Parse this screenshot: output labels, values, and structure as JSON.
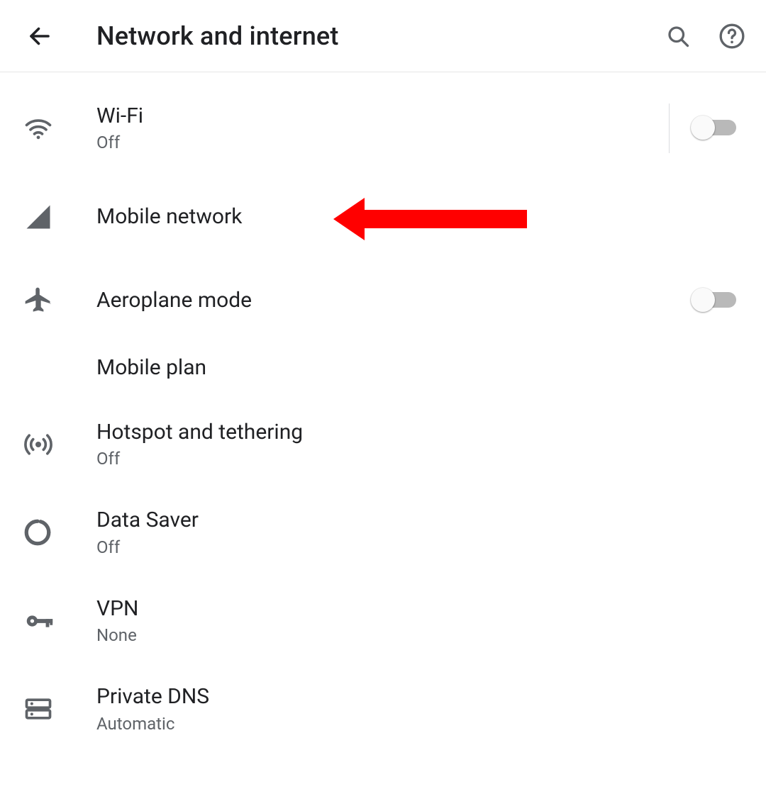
{
  "header": {
    "title": "Network and internet"
  },
  "items": [
    {
      "label": "Wi-Fi",
      "sub": "Off",
      "toggle": "off",
      "divider": true
    },
    {
      "label": "Mobile network",
      "sub": null,
      "toggle": null,
      "highlighted": true
    },
    {
      "label": "Aeroplane mode",
      "sub": null,
      "toggle": "off"
    },
    {
      "label": "Mobile plan",
      "sub": null,
      "toggle": null
    },
    {
      "label": "Hotspot and tethering",
      "sub": "Off",
      "toggle": null
    },
    {
      "label": "Data Saver",
      "sub": "Off",
      "toggle": null
    },
    {
      "label": "VPN",
      "sub": "None",
      "toggle": null
    },
    {
      "label": "Private DNS",
      "sub": "Automatic",
      "toggle": null
    }
  ]
}
